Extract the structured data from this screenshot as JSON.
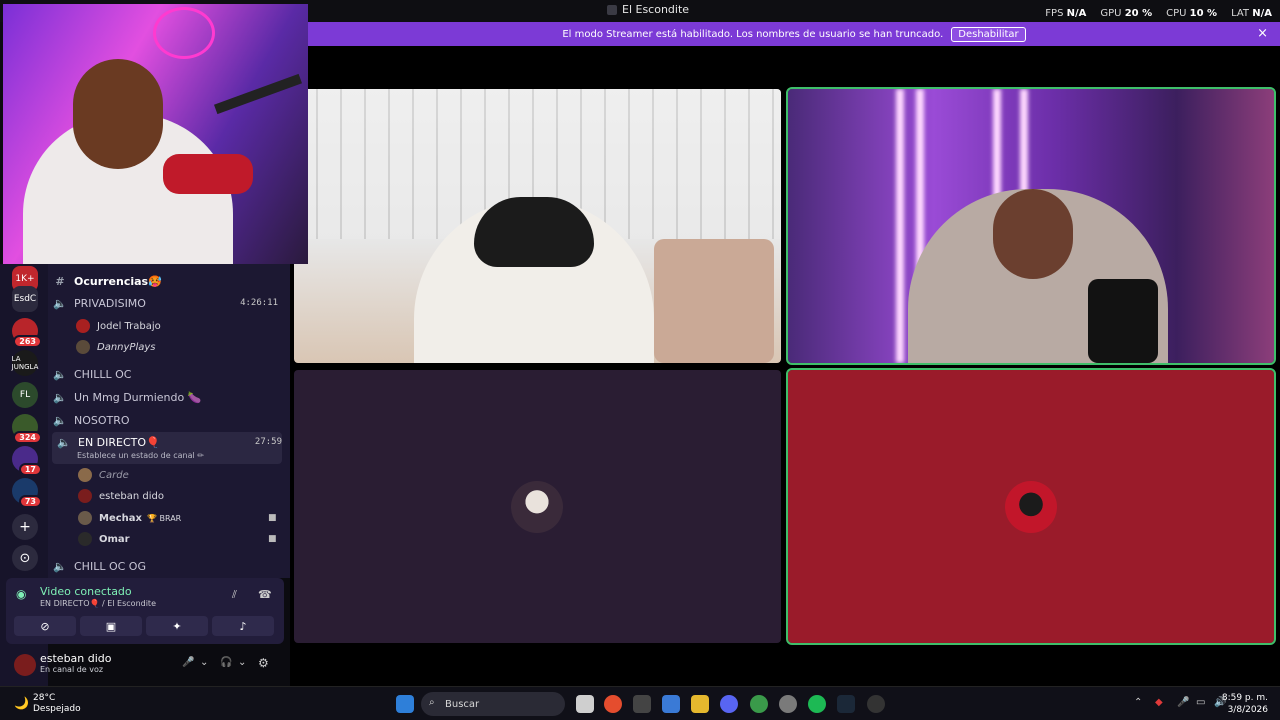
{
  "window": {
    "title": "El Escondite"
  },
  "stats": {
    "fps_label": "FPS",
    "fps_value": "N/A",
    "gpu_label": "GPU",
    "gpu_value": "20 %",
    "cpu_label": "CPU",
    "cpu_value": "10 %",
    "lat_label": "LAT",
    "lat_value": "N/A"
  },
  "banner": {
    "text": "El modo Streamer está habilitado. Los nombres de usuario se han truncado.",
    "button": "Deshabilitar",
    "close_icon": "×"
  },
  "guilds": [
    {
      "label": "1K+",
      "badge": ""
    },
    {
      "label": "EsdC",
      "badge": ""
    },
    {
      "label": "",
      "badge": "263"
    },
    {
      "label": "LA JUNGLA",
      "badge": ""
    },
    {
      "label": "FL",
      "badge": ""
    },
    {
      "label": "",
      "badge": "324"
    },
    {
      "label": "",
      "badge": "17"
    },
    {
      "label": "",
      "badge": "73"
    },
    {
      "label": "+",
      "badge": ""
    },
    {
      "label": "⊙",
      "badge": ""
    }
  ],
  "channels": {
    "c1": {
      "name": "Ocurrencias🥵",
      "icon": "#"
    },
    "c2": {
      "name": "PRIVADISIMO",
      "time": "4:26:11"
    },
    "c2_users": [
      "Jodel Trabajo",
      "DannyPlays"
    ],
    "c3": {
      "name": "CHILLL OC"
    },
    "c4": {
      "name": "Un Mmg Durmiendo 🍆"
    },
    "c5": {
      "name": "NOSOTRO"
    },
    "c6": {
      "name": "EN DIRECTO🎈",
      "time": "27:59",
      "status": "Establece un estado de canal ✏"
    },
    "c6_users": [
      {
        "name": "Carde",
        "tag": ""
      },
      {
        "name": "esteban dido",
        "tag": ""
      },
      {
        "name": "Mechax",
        "tag": "🏆 BRAR"
      },
      {
        "name": "Omar",
        "tag": ""
      }
    ],
    "c7": {
      "name": "CHILL OC OG"
    }
  },
  "voice": {
    "title": "Video conectado",
    "sub": "EN DIRECTO🎈 / El Escondite"
  },
  "user": {
    "name": "esteban dido",
    "status": "En canal de voz"
  },
  "taskbar": {
    "weather_temp": "28°C",
    "weather_desc": "Despejado",
    "search_placeholder": "Buscar",
    "time": "8:59 p. m.",
    "date": "3/8/2026"
  },
  "colors": {
    "accent": "#7c3ad6",
    "speaking": "#3fbf6a",
    "tile_red": "#9a1b2a"
  }
}
